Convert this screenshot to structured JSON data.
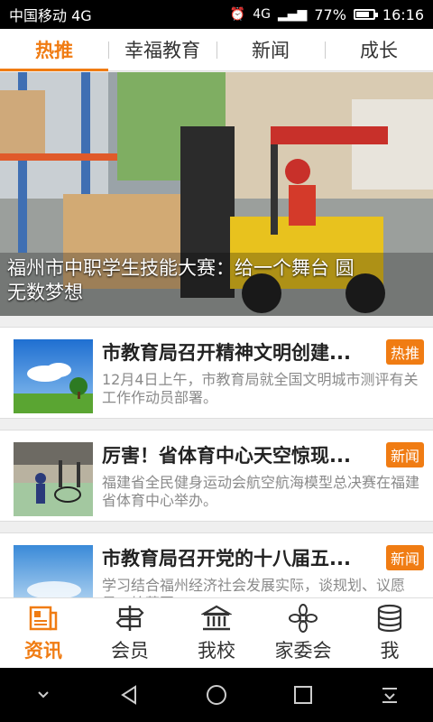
{
  "status_bar": {
    "carrier": "中国移动 4G",
    "network_label": "4G",
    "battery_percent": "77%",
    "battery_level": 0.77,
    "time": "16:16"
  },
  "tabs": [
    {
      "label": "热推",
      "active": true
    },
    {
      "label": "幸福教育",
      "active": false
    },
    {
      "label": "新闻",
      "active": false
    },
    {
      "label": "成长",
      "active": false
    }
  ],
  "banner": {
    "caption": "福州市中职学生技能大赛：给一个舞台  圆无数梦想",
    "dot_count": 6,
    "active_dot": 0
  },
  "news": [
    {
      "title": "市教育局召开精神文明创建...",
      "badge": "热推",
      "desc": "12月4日上午，市教育局就全国文明城市测评有关工作作动员部署。"
    },
    {
      "title": "厉害！省体育中心天空惊现...",
      "badge": "新闻",
      "desc": "福建省全民健身运动会航空航海模型总决赛在福建省体育中心举办。"
    },
    {
      "title": "市教育局召开党的十八届五...",
      "badge": "新闻",
      "desc": "学习结合福州经济社会发展实际，谈规划、议愿景、绘蓝图"
    }
  ],
  "bottom_nav": [
    {
      "label": "资讯",
      "icon": "newspaper-icon",
      "active": true
    },
    {
      "label": "会员",
      "icon": "signpost-icon",
      "active": false
    },
    {
      "label": "我校",
      "icon": "school-building-icon",
      "active": false
    },
    {
      "label": "家委会",
      "icon": "flower-icon",
      "active": false
    },
    {
      "label": "我",
      "icon": "database-icon",
      "active": false
    }
  ],
  "colors": {
    "accent": "#f07c13",
    "status_bar": "#000000"
  }
}
